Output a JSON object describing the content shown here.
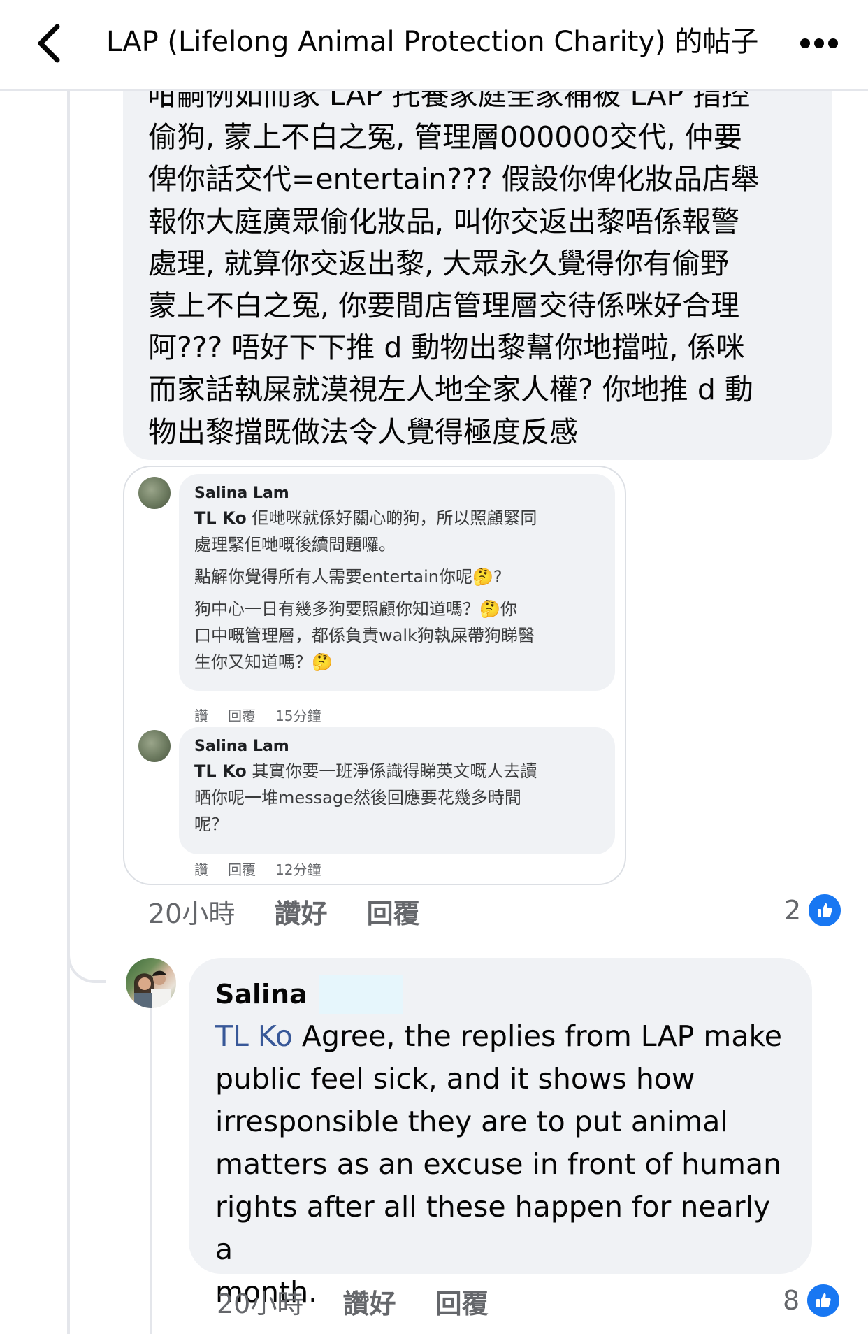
{
  "header": {
    "title": "LAP (Lifelong Animal Protection Charity) 的帖子"
  },
  "comment1": {
    "text_lines": [
      "咁嗣例如而家 LAP 托養家庭全家補被 LAP 指控",
      "偷狗, 蒙上不白之冤, 管理層000000交代, 仲要",
      "俾你話交代=entertain??? 假設你俾化妝品店舉",
      "報你大庭廣眾偷化妝品, 叫你交返出黎唔係報警",
      "處理, 就算你交返出黎, 大眾永久覺得你有偷野",
      "蒙上不白之冤, 你要間店管理層交待係咪好合理",
      "阿??? 唔好下下推 d 動物出黎幫你地擋啦, 係咪",
      "而家話執屎就漠視左人地全家人權? 你地推 d 動",
      "物出黎擋既做法令人覺得極度反感"
    ],
    "time": "20小時",
    "like_label": "讚好",
    "reply_label": "回覆",
    "reaction_count": "2"
  },
  "embed": {
    "c1": {
      "name": "Salina Lam",
      "mention": "TL Ko",
      "line1": " 佢哋咪就係好關心啲狗，所以照顧緊同",
      "line2": "處理緊佢哋嘅後續問題囉。",
      "para2": "點解你覺得所有人需要entertain你呢🤔?",
      "para3a": "狗中心一日有幾多狗要照顧你知道嗎？🤔你",
      "para3b": "口中嘅管理層，都係負責walk狗執屎帶狗睇醫",
      "para3c": "生你又知道嗎？🤔",
      "like": "讚",
      "reply": "回覆",
      "time": "15分鐘"
    },
    "c2": {
      "name": "Salina Lam",
      "mention": "TL Ko",
      "line1": " 其實你要一班淨係識得睇英文嘅人去讀",
      "line2": "晒你呢一堆message然後回應要花幾多時間",
      "line3": "呢？",
      "like": "讚",
      "reply": "回覆",
      "time": "12分鐘"
    }
  },
  "comment2": {
    "author": "Salina",
    "mention": "TL Ko",
    "text": " Agree, the replies from LAP make\npublic feel sick, and it shows how\nirresponsible they are to put animal\nmatters as an excuse in front of human\nrights after all these happen for nearly a\nmonth.",
    "time": "20小時",
    "like_label": "讚好",
    "reply_label": "回覆",
    "reaction_count": "8"
  },
  "colors": {
    "bubble": "#f0f2f5",
    "like_blue": "#1877f2",
    "mention": "#385898",
    "secondary_text": "#65676b"
  },
  "icons": [
    "back-chevron-icon",
    "more-dots-icon",
    "like-thumb-icon"
  ]
}
